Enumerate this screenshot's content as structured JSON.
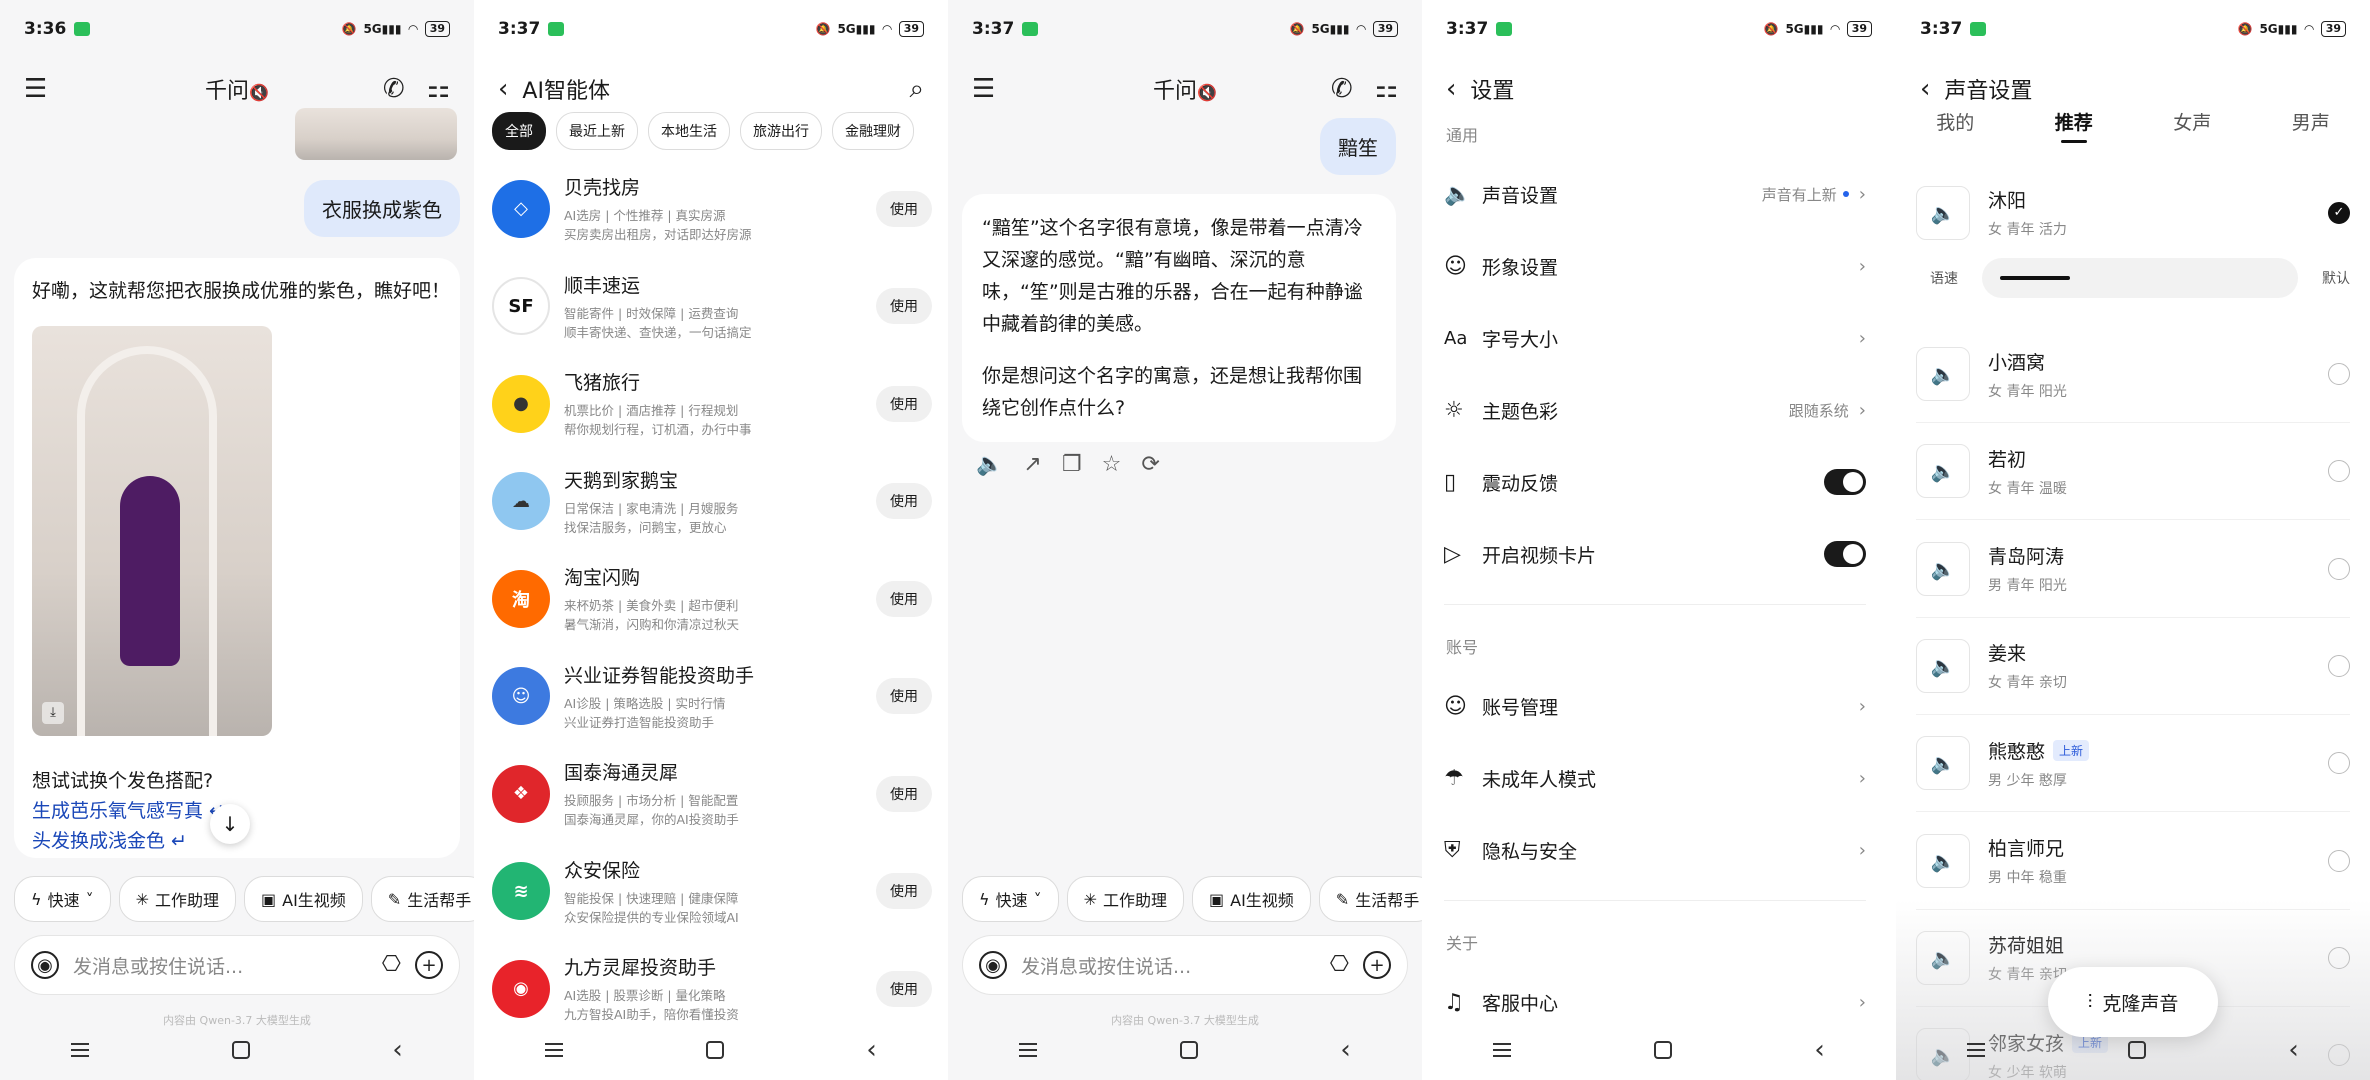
{
  "status": [
    {
      "time": "3:36",
      "battery": "39"
    },
    {
      "time": "3:37",
      "battery": "39"
    },
    {
      "time": "3:37",
      "battery": "39"
    },
    {
      "time": "3:37",
      "battery": "39"
    },
    {
      "time": "3:37",
      "battery": "39"
    }
  ],
  "chat1": {
    "title": "千问",
    "user_msg": "衣服换成紫色",
    "bot_msg": "好嘞，这就帮您把衣服换成优雅的紫色，瞧好吧！",
    "suggest_title": "想试试换个发色搭配?",
    "suggestions": [
      "生成芭乐氧气感写真",
      "头发换成浅金色"
    ]
  },
  "chips": [
    "快速",
    "工作助理",
    "AI生视频",
    "生活帮手"
  ],
  "input_placeholder": "发消息或按住说话...",
  "footer_note": "内容由 Qwen-3.7 大模型生成",
  "agents_page": {
    "title": "AI智能体",
    "tabs": [
      "全部",
      "最近上新",
      "本地生活",
      "旅游出行",
      "金融理财"
    ],
    "use_label": "使用",
    "agents": [
      {
        "name": "贝壳找房",
        "sub1": "AI选房 | 个性推荐 | 真实房源",
        "sub2": "买房卖房出租房，对话即达好房源",
        "color": "#1e6fe6",
        "glyph": "◇"
      },
      {
        "name": "顺丰速运",
        "sub1": "智能寄件 | 时效保障 | 运费查询",
        "sub2": "顺丰寄快递、查快递，一句话搞定",
        "color": "#222222",
        "glyph": "SF"
      },
      {
        "name": "飞猪旅行",
        "sub1": "机票比价 | 酒店推荐 | 行程规划",
        "sub2": "帮你规划行程，订机酒，办行中事",
        "color": "#ffd21a",
        "glyph": "●"
      },
      {
        "name": "天鹅到家鹅宝",
        "sub1": "日常保洁 | 家电清洗 | 月嫂服务",
        "sub2": "找保洁服务，问鹅宝，更放心",
        "color": "#8fc7f0",
        "glyph": "☁"
      },
      {
        "name": "淘宝闪购",
        "sub1": "来杯奶茶 | 美食外卖 | 超市便利",
        "sub2": "暑气渐消，闪购和你清凉过秋天",
        "color": "#ff6a00",
        "glyph": "淘"
      },
      {
        "name": "兴业证券智能投资助手",
        "sub1": "AI诊股 | 策略选股 | 实时行情",
        "sub2": "兴业证券打造智能投资助手",
        "color": "#3d7ae0",
        "glyph": "☺"
      },
      {
        "name": "国泰海通灵犀",
        "sub1": "投顾服务 | 市场分析 | 智能配置",
        "sub2": "国泰海通灵犀，你的AI投资助手",
        "color": "#e0262b",
        "glyph": "❖"
      },
      {
        "name": "众安保险",
        "sub1": "智能投保 | 快速理赔 | 健康保障",
        "sub2": "众安保险提供的专业保险领域AI",
        "color": "#22b573",
        "glyph": "≋"
      },
      {
        "name": "九方灵犀投资助手",
        "sub1": "AI选股 | 股票诊断 | 量化策略",
        "sub2": "九方智投AI助手，陪你看懂投资",
        "color": "#e8232a",
        "glyph": "◉"
      }
    ]
  },
  "chat2": {
    "title": "千问",
    "user_msg": "黯笙",
    "reply_p1": "“黯笙”这个名字很有意境，像是带着一点清冷又深邃的感觉。“黯”有幽暗、深沉的意味，“笙”则是古雅的乐器，合在一起有种静谧中藏着韵律的美感。",
    "reply_p2": "你是想问这个名字的寓意，还是想让我帮你围绕它创作点什么?"
  },
  "settings": {
    "title": "设置",
    "sec_general": "通用",
    "sec_account": "账号",
    "sec_about": "关于",
    "voice": "声音设置",
    "voice_val": "声音有上新",
    "image": "形象设置",
    "font": "字号大小",
    "theme": "主题色彩",
    "theme_val": "跟随系统",
    "vibrate": "震动反馈",
    "video_card": "开启视频卡片",
    "account": "账号管理",
    "minor": "未成年人模式",
    "privacy": "隐私与安全",
    "support": "客服中心"
  },
  "voice_page": {
    "title": "声音设置",
    "tabs": [
      "我的",
      "推荐",
      "女声",
      "男声"
    ],
    "speed_label": "语速",
    "speed_default": "默认",
    "speed_level": 0.22,
    "new_tag": "上新",
    "clone": "克隆声音",
    "voices": [
      {
        "name": "沐阳",
        "tags": "女 青年 活力"
      },
      {
        "name": "小酒窝",
        "tags": "女 青年 阳光"
      },
      {
        "name": "若初",
        "tags": "女 青年 温暖"
      },
      {
        "name": "青岛阿涛",
        "tags": "男 青年 阳光"
      },
      {
        "name": "姜来",
        "tags": "女 青年 亲切"
      },
      {
        "name": "熊憨憨",
        "tags": "男 少年 憨厚"
      },
      {
        "name": "柏言师兄",
        "tags": "男 中年 稳重"
      },
      {
        "name": "苏荷姐姐",
        "tags": "女 青年 亲切"
      },
      {
        "name": "邻家女孩",
        "tags": "女 少年 软萌"
      }
    ]
  }
}
